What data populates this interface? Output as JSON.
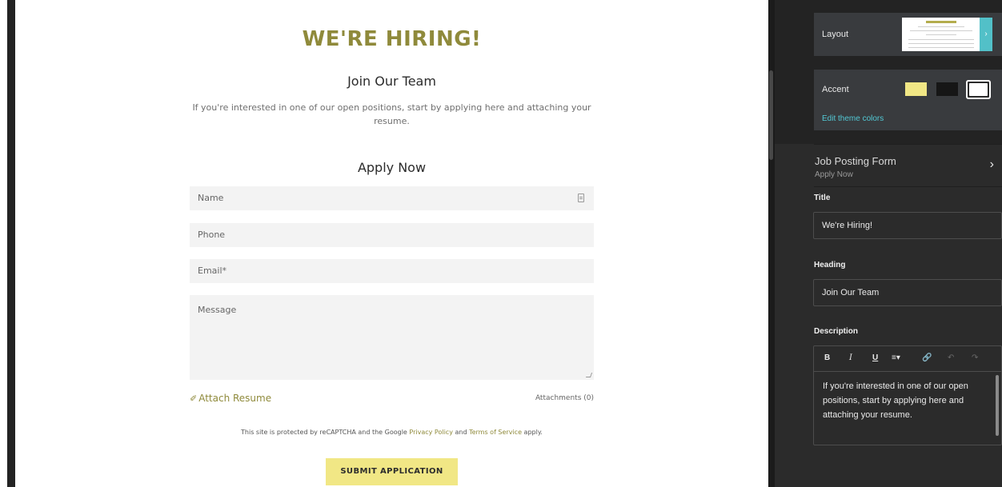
{
  "preview": {
    "title": "WE'RE HIRING!",
    "heading": "Join Our Team",
    "intro": "If you're interested in one of our open positions, start by applying here and attaching your resume.",
    "apply_heading": "Apply Now",
    "fields": {
      "name_placeholder": "Name",
      "phone_placeholder": "Phone",
      "email_placeholder": "Email*",
      "message_placeholder": "Message"
    },
    "attach_label": "Attach Resume",
    "attachments_label": "Attachments (0)",
    "recaptcha": {
      "prefix": "This site is protected by reCAPTCHA and the Google ",
      "privacy": "Privacy Policy",
      "and": " and ",
      "terms": "Terms of Service",
      "suffix": " apply."
    },
    "submit_label": "SUBMIT APPLICATION"
  },
  "panel": {
    "layout_label": "Layout",
    "accent_label": "Accent",
    "edit_theme_label": "Edit theme colors",
    "form_row": {
      "title": "Job Posting Form",
      "subtitle": "Apply Now"
    },
    "title_label": "Title",
    "title_value": "We're Hiring!",
    "heading_label": "Heading",
    "heading_value": "Join Our Team",
    "description_label": "Description",
    "description_value": "If you're interested in one of our open positions, start by applying here and attaching your resume.",
    "toolbar": {
      "bold": "B",
      "italic": "I",
      "underline": "U",
      "list": "≡▾",
      "link": "🔗",
      "undo": "↶",
      "redo": "↷"
    }
  },
  "colors": {
    "accent_olive": "#8f8a3b",
    "accent_yellow": "#f1e785",
    "accent_black": "#161616",
    "accent_white": "#ffffff",
    "panel_link_teal": "#52c8d4"
  }
}
